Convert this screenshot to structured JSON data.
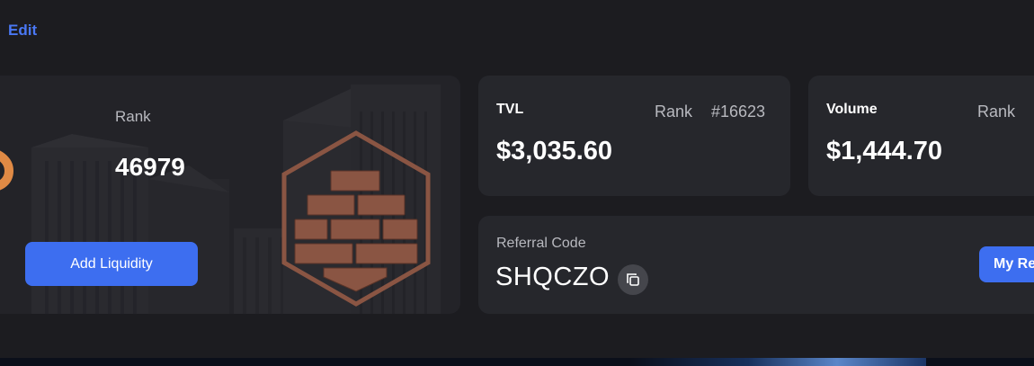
{
  "header": {
    "edit_label": "Edit"
  },
  "profile": {
    "rank_label": "Rank",
    "rank_value": "46979",
    "add_liquidity_label": "Add Liquidity",
    "badge_icon": "brick-wall-hexagon-icon",
    "badge_color": "#8a5543",
    "avatar_icon": "orange-partial-glyph-icon"
  },
  "tvl": {
    "label": "TVL",
    "rank_label": "Rank",
    "rank_value": "#16623",
    "value": "$3,035.60"
  },
  "volume": {
    "label": "Volume",
    "rank_label": "Rank",
    "value": "$1,444.70"
  },
  "referral": {
    "label": "Referral Code",
    "code": "SHQCZO",
    "copy_icon": "copy-icon",
    "my_referrals_label": "My Re"
  },
  "colors": {
    "accent": "#3d6ef0",
    "link": "#4a78f5",
    "card": "#26272c",
    "background": "#1c1c20",
    "muted_text": "#b8b9bf"
  }
}
